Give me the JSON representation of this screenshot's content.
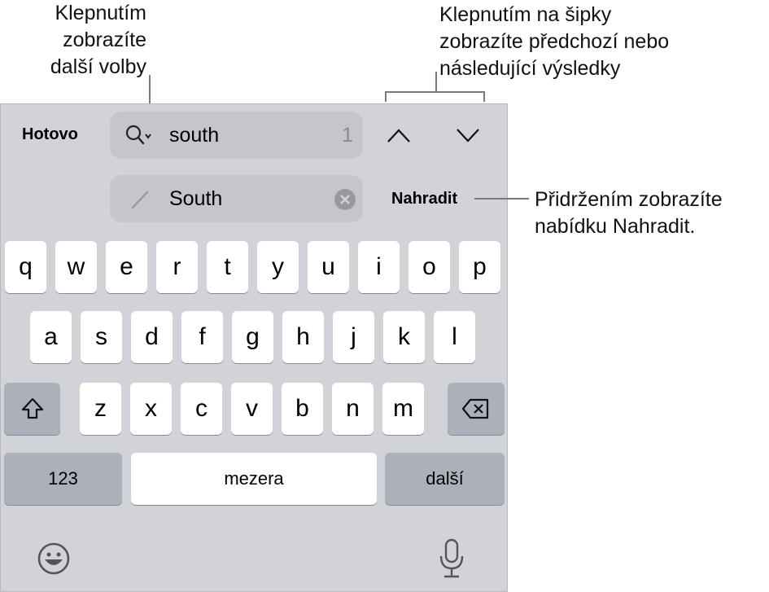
{
  "annotations": {
    "options": [
      "Klepnutím",
      "zobrazíte",
      "další volby"
    ],
    "arrows": [
      "Klepnutím na šipky",
      "zobrazíte předchozí nebo",
      "následující výsledky"
    ],
    "replace": [
      "Přidržením zobrazíte",
      "nabídku Nahradit."
    ]
  },
  "find_bar": {
    "done_label": "Hotovo",
    "search_value": "south",
    "match_count": "1",
    "replace_value": "South",
    "replace_label": "Nahradit"
  },
  "keyboard": {
    "row1": [
      "q",
      "w",
      "e",
      "r",
      "t",
      "y",
      "u",
      "i",
      "o",
      "p"
    ],
    "row2": [
      "a",
      "s",
      "d",
      "f",
      "g",
      "h",
      "j",
      "k",
      "l"
    ],
    "row3": [
      "z",
      "x",
      "c",
      "v",
      "b",
      "n",
      "m"
    ],
    "numbers_label": "123",
    "space_label": "mezera",
    "next_label": "další"
  },
  "colors": {
    "background": "#d1d3d9",
    "key": "#ffffff",
    "special_key": "#abb0ba"
  }
}
